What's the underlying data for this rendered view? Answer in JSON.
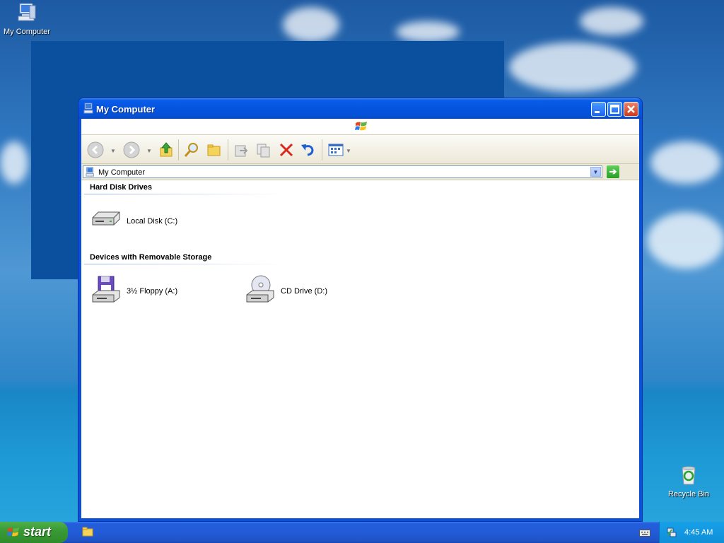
{
  "desktop": {
    "icons": [
      {
        "label": "My Computer"
      },
      {
        "label": "Recycle Bin"
      }
    ]
  },
  "window": {
    "title": "My Computer",
    "address": {
      "value": "My Computer"
    },
    "groups": [
      {
        "heading": "Hard Disk Drives",
        "items": [
          {
            "label": "Local Disk (C:)",
            "icon": "hard-disk-icon"
          }
        ]
      },
      {
        "heading": "Devices with Removable Storage",
        "items": [
          {
            "label": "3½ Floppy (A:)",
            "icon": "floppy-drive-icon"
          },
          {
            "label": "CD Drive (D:)",
            "icon": "cd-drive-icon"
          }
        ]
      }
    ]
  },
  "taskbar": {
    "start_label": "start",
    "clock": "4:45 AM"
  },
  "colors": {
    "titlebar": "#0554e0",
    "taskbar": "#245edc",
    "start_button": "#3a9a36",
    "tray": "#0f8fd8"
  }
}
